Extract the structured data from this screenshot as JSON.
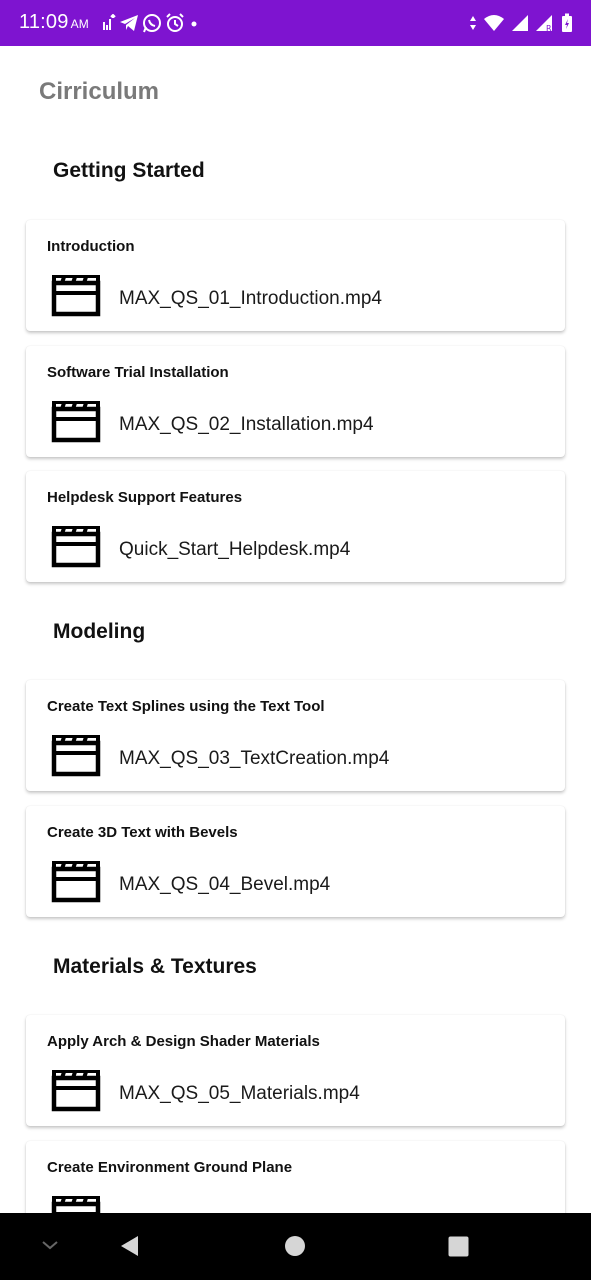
{
  "status_bar": {
    "time": "11:09",
    "ampm": "AM"
  },
  "page": {
    "title": "Cirriculum"
  },
  "sections": [
    {
      "title": "Getting Started",
      "items": [
        {
          "title": "Introduction",
          "file": "MAX_QS_01_Introduction.mp4"
        },
        {
          "title": "Software Trial Installation",
          "file": "MAX_QS_02_Installation.mp4"
        },
        {
          "title": "Helpdesk Support Features",
          "file": "Quick_Start_Helpdesk.mp4"
        }
      ]
    },
    {
      "title": "Modeling",
      "items": [
        {
          "title": "Create Text Splines using the Text Tool",
          "file": "MAX_QS_03_TextCreation.mp4"
        },
        {
          "title": "Create 3D Text with Bevels",
          "file": "MAX_QS_04_Bevel.mp4"
        }
      ]
    },
    {
      "title": "Materials & Textures",
      "items": [
        {
          "title": "Apply Arch & Design Shader Materials",
          "file": "MAX_QS_05_Materials.mp4"
        },
        {
          "title": "Create Environment Ground Plane",
          "file": ""
        }
      ]
    }
  ],
  "colors": {
    "status_bar": "#7e14d0",
    "page_title": "#7a7a7a",
    "nav_bar": "#000000"
  },
  "icons": {
    "video_file": "clapperboard-icon",
    "nav_back": "triangle-back-icon",
    "nav_home": "circle-home-icon",
    "nav_recents": "square-recents-icon",
    "nav_collapse": "chevron-down-icon"
  }
}
